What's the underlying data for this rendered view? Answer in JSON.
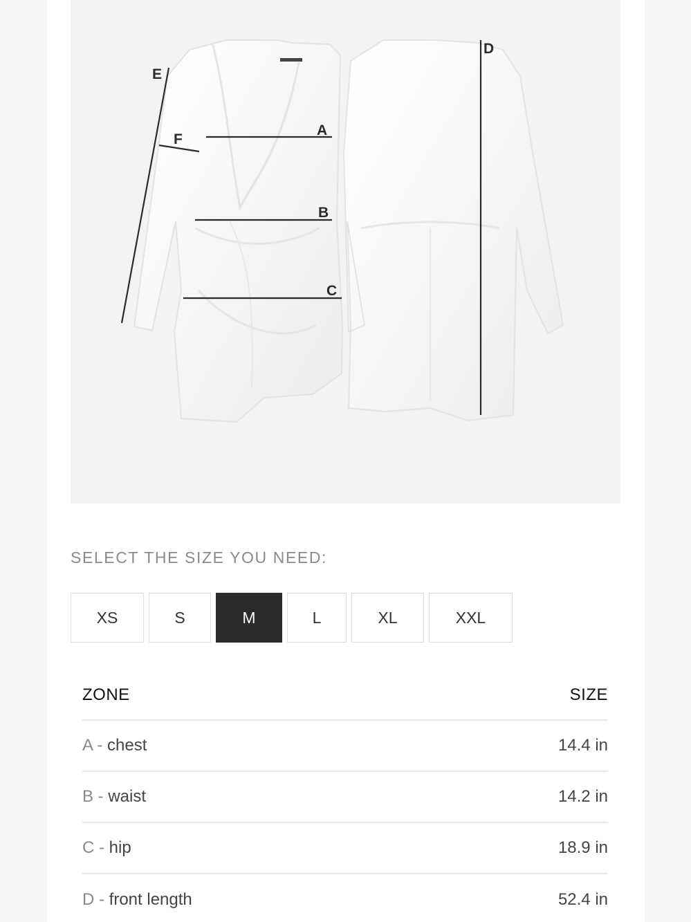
{
  "diagram_labels": {
    "a": "A",
    "b": "B",
    "c": "C",
    "d": "D",
    "e": "E",
    "f": "F"
  },
  "size_section": {
    "heading": "SELECT THE SIZE YOU NEED:",
    "sizes": [
      "XS",
      "S",
      "M",
      "L",
      "XL",
      "XXL"
    ],
    "selected": "M"
  },
  "table": {
    "header_zone": "ZONE",
    "header_size": "SIZE",
    "rows": [
      {
        "code": "A",
        "separator": " - ",
        "zone": "chest",
        "value": "14.4 in"
      },
      {
        "code": "B",
        "separator": " - ",
        "zone": "waist",
        "value": "14.2 in"
      },
      {
        "code": "C",
        "separator": " - ",
        "zone": "hip",
        "value": "18.9 in"
      },
      {
        "code": "D",
        "separator": " - ",
        "zone": "front length",
        "value": "52.4 in"
      }
    ]
  },
  "colors": {
    "selected_bg": "#2a2a2a",
    "image_bg": "#f3f3f5",
    "divider": "#e6e6e6"
  }
}
